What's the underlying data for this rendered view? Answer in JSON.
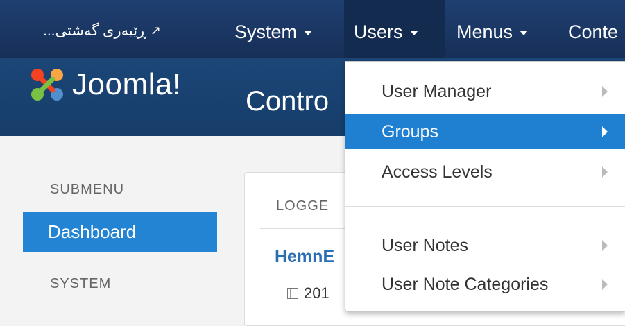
{
  "navbar": {
    "site_link": "...ڕێیەری گەشتی",
    "items": [
      {
        "label": "System"
      },
      {
        "label": "Users"
      },
      {
        "label": "Menus"
      },
      {
        "label": "Conte"
      }
    ]
  },
  "header": {
    "logo_text": "Joomla!",
    "page_title": "Contro"
  },
  "sidebar": {
    "submenu_heading": "SUBMENU",
    "dashboard": "Dashboard",
    "system_heading": "SYSTEM"
  },
  "panel": {
    "heading": "LOGGE",
    "user": "HemnE",
    "date": "201"
  },
  "dropdown": {
    "items": [
      {
        "label": "User Manager"
      },
      {
        "label": "Groups"
      },
      {
        "label": "Access Levels"
      },
      {
        "label": "User Notes"
      },
      {
        "label": "User Note Categories"
      }
    ]
  },
  "colors": {
    "navbar": "#1a3867",
    "header": "#1b4677",
    "accent": "#1f7fd0",
    "link": "#2a6eb5"
  }
}
